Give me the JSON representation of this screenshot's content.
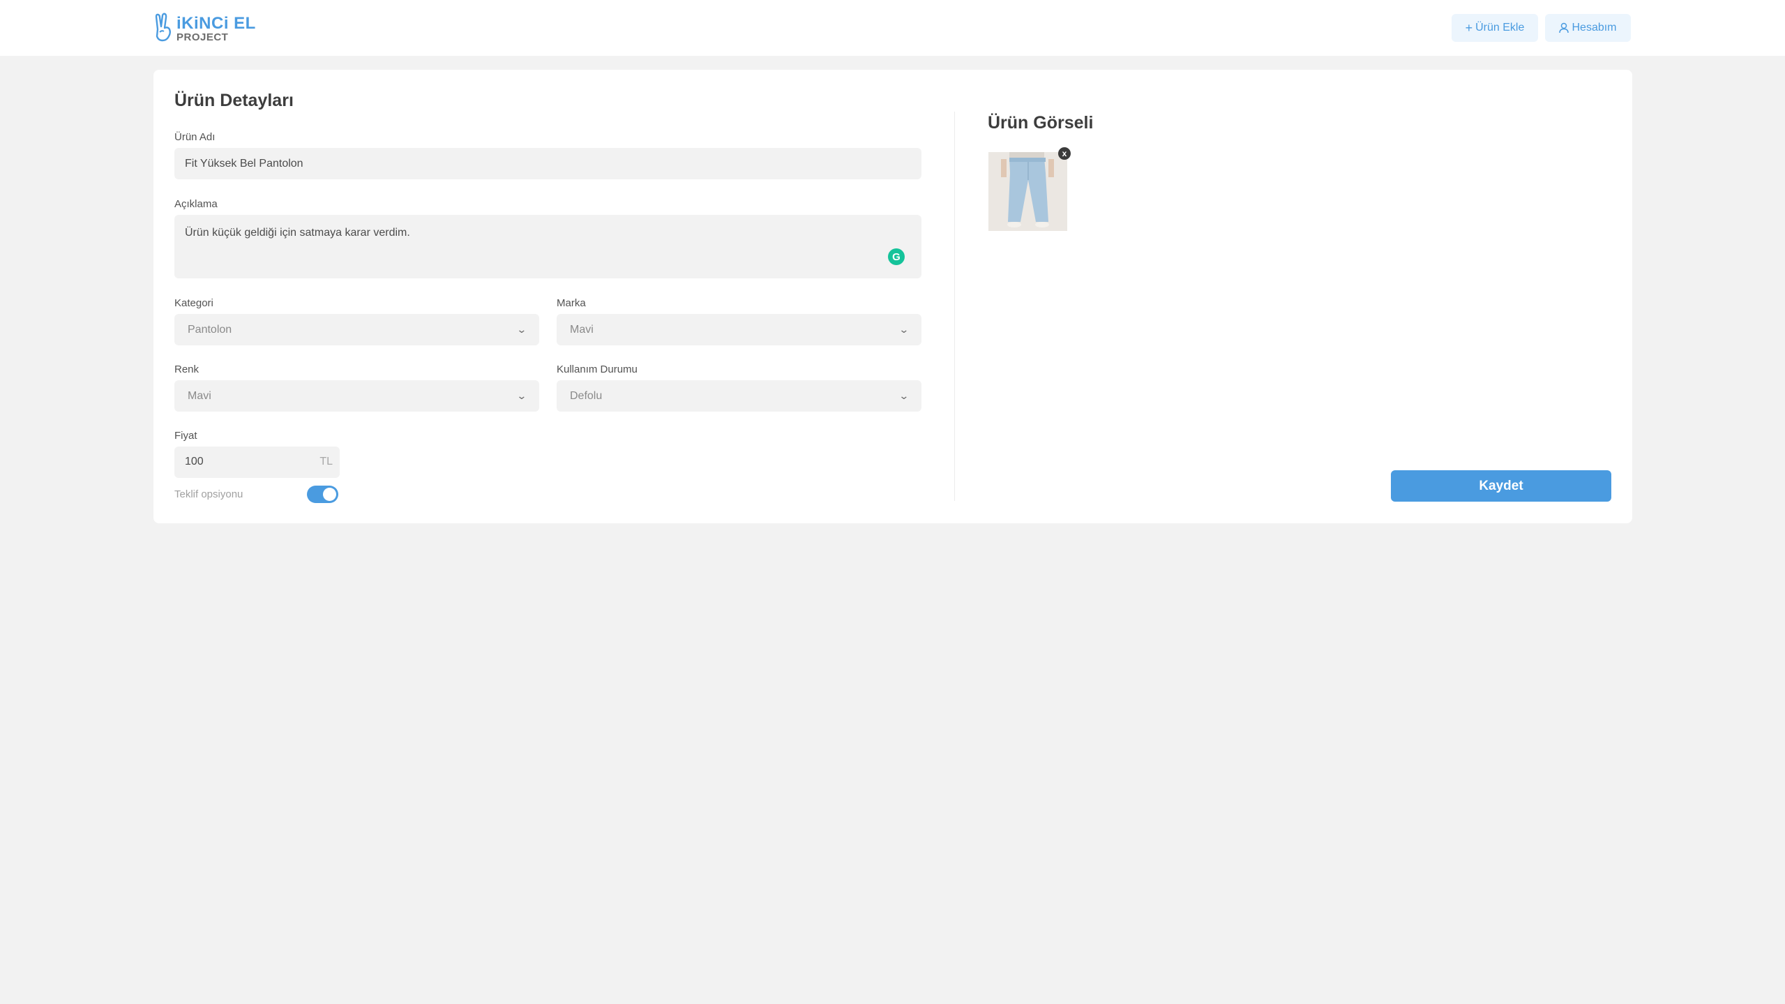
{
  "header": {
    "logo_title": "iKiNCi EL",
    "logo_subtitle": "PROJECT",
    "add_product_label": "Ürün Ekle",
    "account_label": "Hesabım",
    "add_icon": "plus-icon",
    "account_icon": "user-icon"
  },
  "form": {
    "title": "Ürün Detayları",
    "name_label": "Ürün Adı",
    "name_value": "Fit Yüksek Bel Pantolon",
    "description_label": "Açıklama",
    "description_value": "Ürün küçük geldiği için satmaya karar verdim.",
    "category_label": "Kategori",
    "category_value": "Pantolon",
    "brand_label": "Marka",
    "brand_value": "Mavi",
    "color_label": "Renk",
    "color_value": "Mavi",
    "condition_label": "Kullanım Durumu",
    "condition_value": "Defolu",
    "price_label": "Fiyat",
    "price_value": "100",
    "price_unit": "TL",
    "offer_label": "Teklif opsiyonu",
    "offer_enabled": true
  },
  "image_panel": {
    "title": "Ürün Görseli",
    "remove_symbol": "x"
  },
  "actions": {
    "save_label": "Kaydet"
  },
  "colors": {
    "accent": "#4a9be0",
    "background": "#f2f2f2",
    "grammarly": "#15c39a"
  }
}
